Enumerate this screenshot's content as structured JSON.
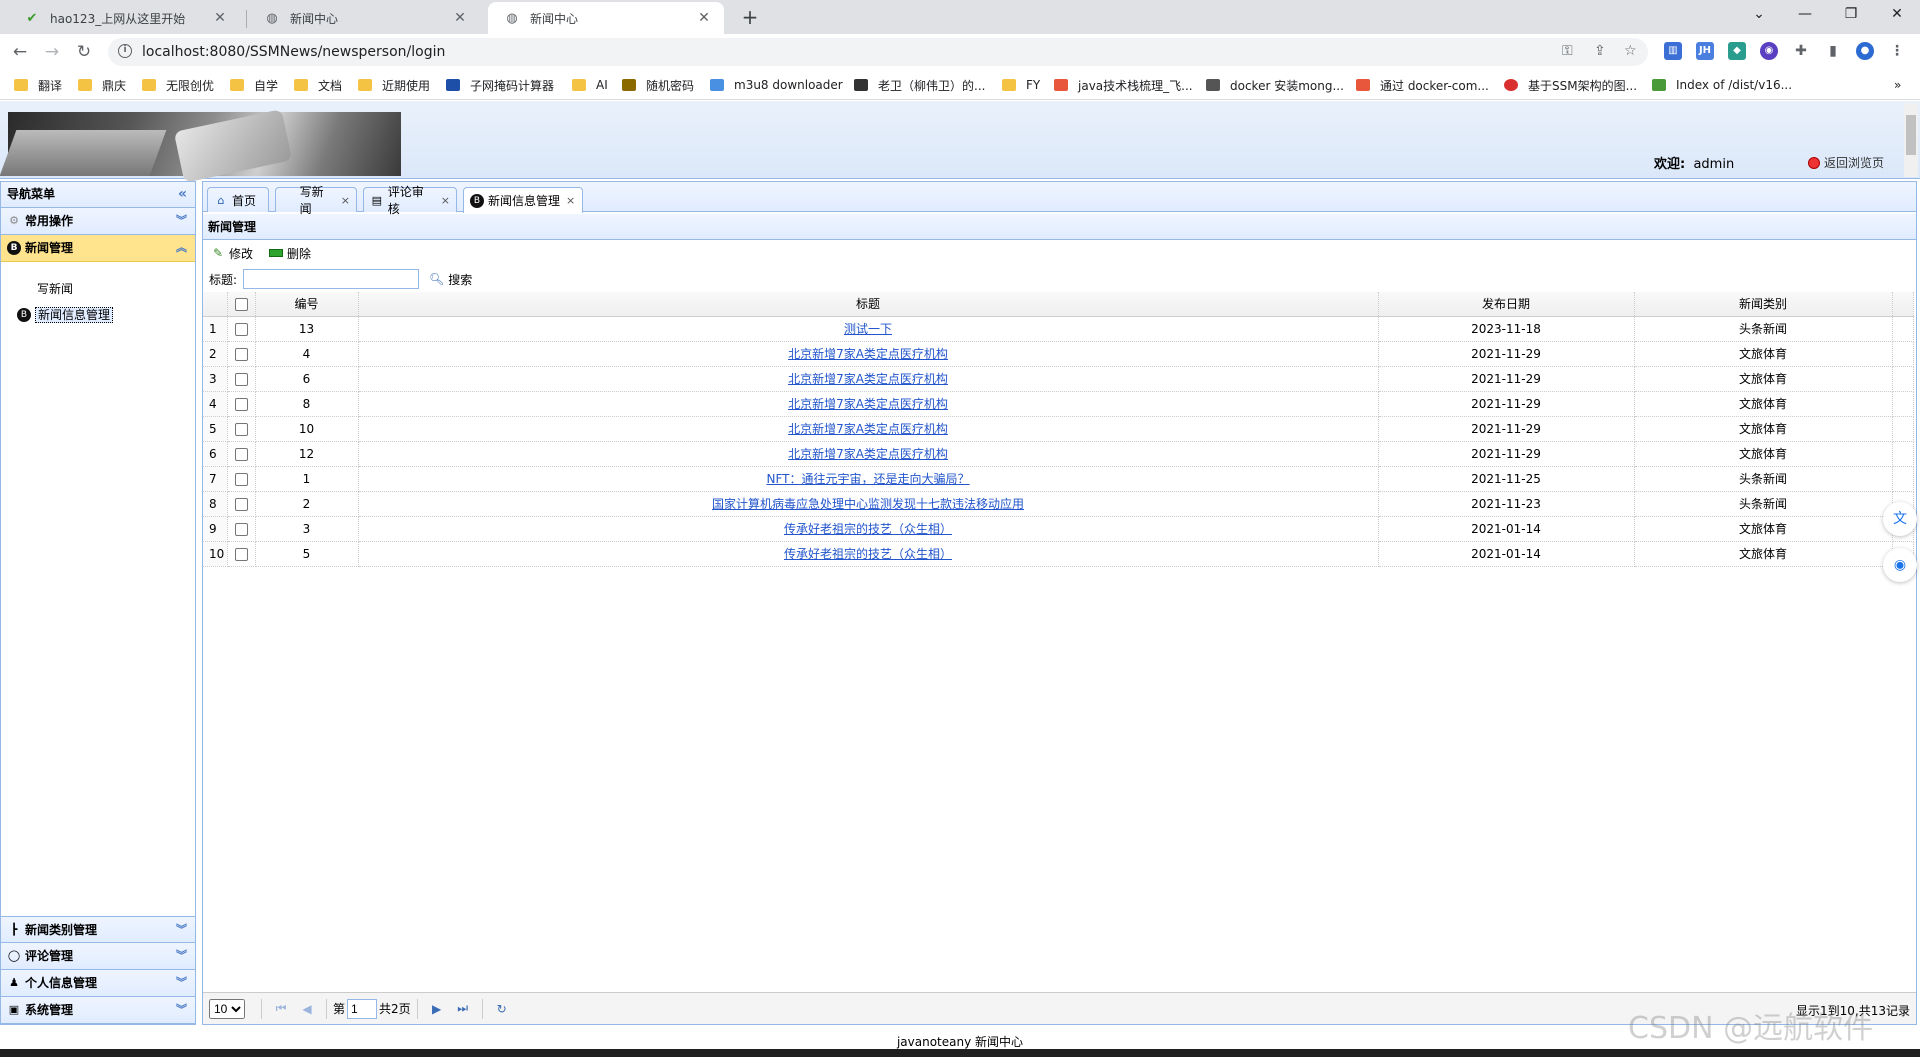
{
  "browser": {
    "tabs": [
      {
        "title": "hao123_上网从这里开始",
        "icon": "hao123-favicon"
      },
      {
        "title": "新闻中心",
        "icon": "globe-icon"
      },
      {
        "title": "新闻中心",
        "icon": "globe-icon",
        "active": true
      }
    ],
    "url": "localhost:8080/SSMNews/newsperson/login",
    "bookmarks": [
      "翻译",
      "鼎庆",
      "无限创优",
      "自学",
      "文档",
      "近期使用",
      "子网掩码计算器",
      "AI",
      "随机密码",
      "m3u8 downloader",
      "老卫（柳伟卫）的...",
      "FY",
      "java技术栈梳理_飞...",
      "docker 安装mong...",
      "通过 docker-com...",
      "基于SSM架构的图...",
      "Index of /dist/v16..."
    ],
    "more_bookmarks": "»"
  },
  "header": {
    "welcome_label": "欢迎:",
    "username": "admin",
    "back_label": "返回浏览页"
  },
  "sidebar": {
    "title": "导航菜单",
    "groups": [
      {
        "label": "常用操作"
      },
      {
        "label": "新闻管理",
        "items": [
          "写新闻",
          "新闻信息管理"
        ]
      },
      {
        "label": "新闻类别管理"
      },
      {
        "label": "评论管理"
      },
      {
        "label": "个人信息管理"
      },
      {
        "label": "系统管理"
      }
    ]
  },
  "content_tabs": [
    {
      "label": "首页"
    },
    {
      "label": "写新闻"
    },
    {
      "label": "评论审核"
    },
    {
      "label": "新闻信息管理"
    }
  ],
  "panel": {
    "title": "新闻管理",
    "edit_label": "修改",
    "delete_label": "删除",
    "search_label": "标题:",
    "search_value": "",
    "search_button": "搜索"
  },
  "grid": {
    "columns": [
      "编号",
      "标题",
      "发布日期",
      "新闻类别"
    ],
    "rows": [
      {
        "n": "1",
        "id": "13",
        "title": "测试一下",
        "date": "2023-11-18",
        "type": "头条新闻"
      },
      {
        "n": "2",
        "id": "4",
        "title": "北京新增7家A类定点医疗机构",
        "date": "2021-11-29",
        "type": "文旅体育"
      },
      {
        "n": "3",
        "id": "6",
        "title": "北京新增7家A类定点医疗机构",
        "date": "2021-11-29",
        "type": "文旅体育"
      },
      {
        "n": "4",
        "id": "8",
        "title": "北京新增7家A类定点医疗机构",
        "date": "2021-11-29",
        "type": "文旅体育"
      },
      {
        "n": "5",
        "id": "10",
        "title": "北京新增7家A类定点医疗机构",
        "date": "2021-11-29",
        "type": "文旅体育"
      },
      {
        "n": "6",
        "id": "12",
        "title": "北京新增7家A类定点医疗机构",
        "date": "2021-11-29",
        "type": "文旅体育"
      },
      {
        "n": "7",
        "id": "1",
        "title": "NFT：通往元宇宙，还是走向大骗局？",
        "date": "2021-11-25",
        "type": "头条新闻"
      },
      {
        "n": "8",
        "id": "2",
        "title": "国家计算机病毒应急处理中心监测发现十七款违法移动应用",
        "date": "2021-11-23",
        "type": "头条新闻"
      },
      {
        "n": "9",
        "id": "3",
        "title": "传承好老祖宗的技艺（众生相）",
        "date": "2021-01-14",
        "type": "文旅体育"
      },
      {
        "n": "10",
        "id": "5",
        "title": "传承好老祖宗的技艺（众生相）",
        "date": "2021-01-14",
        "type": "文旅体育"
      }
    ]
  },
  "pager": {
    "page_size": "10",
    "page_prefix": "第",
    "current_page": "1",
    "page_total": "共2页",
    "info": "显示1到10,共13记录"
  },
  "footer": "javanoteany 新闻中心",
  "watermark": "CSDN @远航软件"
}
